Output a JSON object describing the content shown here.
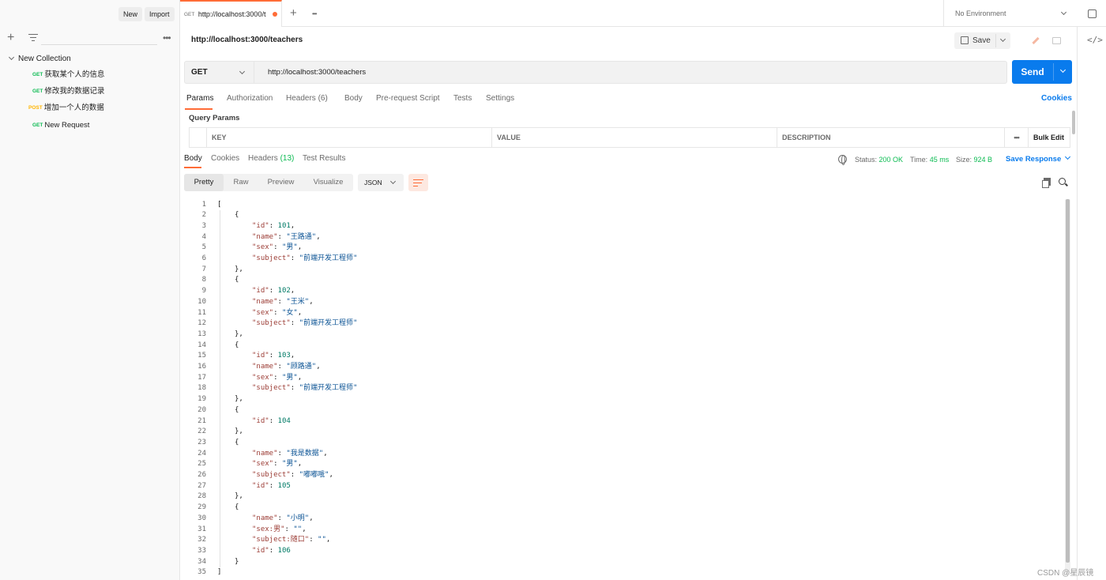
{
  "sidebar": {
    "new_label": "New",
    "import_label": "Import",
    "collection_name": "New Collection",
    "requests": [
      {
        "method": "GET",
        "name": "获取某个人的信息"
      },
      {
        "method": "GET",
        "name": "修改我的数据记录"
      },
      {
        "method": "POST",
        "name": "增加一个人的数据"
      },
      {
        "method": "GET",
        "name": "New Request"
      }
    ]
  },
  "tabs": {
    "active_tab": {
      "method": "GET",
      "title": "http://localhost:3000/t"
    },
    "environment": "No Environment"
  },
  "request": {
    "title": "http://localhost:3000/teachers",
    "save_label": "Save",
    "method": "GET",
    "url": "http://localhost:3000/teachers",
    "send_label": "Send",
    "tabs": [
      "Params",
      "Authorization",
      "Headers",
      "Body",
      "Pre-request Script",
      "Tests",
      "Settings"
    ],
    "headers_count": "(6)",
    "cookies_label": "Cookies",
    "query_params_title": "Query Params",
    "params_columns": [
      "KEY",
      "VALUE",
      "DESCRIPTION"
    ],
    "bulk_edit_label": "Bulk Edit"
  },
  "response": {
    "tabs": [
      "Body",
      "Cookies",
      "Headers",
      "Test Results"
    ],
    "headers_count": "(13)",
    "status_label": "Status:",
    "status_value": "200 OK",
    "time_label": "Time:",
    "time_value": "45 ms",
    "size_label": "Size:",
    "size_value": "924 B",
    "save_response_label": "Save Response",
    "view_modes": [
      "Pretty",
      "Raw",
      "Preview",
      "Visualize"
    ],
    "format": "JSON",
    "line_numbers": [
      "1",
      "2",
      "3",
      "4",
      "5",
      "6",
      "7",
      "8",
      "9",
      "10",
      "11",
      "12",
      "13",
      "14",
      "15",
      "16",
      "17",
      "18",
      "19",
      "20",
      "21",
      "22",
      "23",
      "24",
      "25",
      "26",
      "27",
      "28",
      "29",
      "30",
      "31",
      "32",
      "33",
      "34",
      "35"
    ],
    "lines": [
      {
        "indent": 0,
        "text": "["
      },
      {
        "indent": 1,
        "text": "{"
      },
      {
        "indent": 2,
        "key": "\"id\"",
        "num": "101",
        "tail": ","
      },
      {
        "indent": 2,
        "key": "\"name\"",
        "str": "\"王路通\"",
        "tail": ","
      },
      {
        "indent": 2,
        "key": "\"sex\"",
        "str": "\"男\"",
        "tail": ","
      },
      {
        "indent": 2,
        "key": "\"subject\"",
        "str": "\"前端开发工程师\"",
        "tail": ""
      },
      {
        "indent": 1,
        "text": "},"
      },
      {
        "indent": 1,
        "text": "{"
      },
      {
        "indent": 2,
        "key": "\"id\"",
        "num": "102",
        "tail": ","
      },
      {
        "indent": 2,
        "key": "\"name\"",
        "str": "\"王米\"",
        "tail": ","
      },
      {
        "indent": 2,
        "key": "\"sex\"",
        "str": "\"女\"",
        "tail": ","
      },
      {
        "indent": 2,
        "key": "\"subject\"",
        "str": "\"前端开发工程师\"",
        "tail": ""
      },
      {
        "indent": 1,
        "text": "},"
      },
      {
        "indent": 1,
        "text": "{"
      },
      {
        "indent": 2,
        "key": "\"id\"",
        "num": "103",
        "tail": ","
      },
      {
        "indent": 2,
        "key": "\"name\"",
        "str": "\"顾路通\"",
        "tail": ","
      },
      {
        "indent": 2,
        "key": "\"sex\"",
        "str": "\"男\"",
        "tail": ","
      },
      {
        "indent": 2,
        "key": "\"subject\"",
        "str": "\"前端开发工程师\"",
        "tail": ""
      },
      {
        "indent": 1,
        "text": "},"
      },
      {
        "indent": 1,
        "text": "{"
      },
      {
        "indent": 2,
        "key": "\"id\"",
        "num": "104",
        "tail": ""
      },
      {
        "indent": 1,
        "text": "},"
      },
      {
        "indent": 1,
        "text": "{"
      },
      {
        "indent": 2,
        "key": "\"name\"",
        "str": "\"我是数据\"",
        "tail": ","
      },
      {
        "indent": 2,
        "key": "\"sex\"",
        "str": "\"男\"",
        "tail": ","
      },
      {
        "indent": 2,
        "key": "\"subject\"",
        "str": "\"嘟嘟哦\"",
        "tail": ","
      },
      {
        "indent": 2,
        "key": "\"id\"",
        "num": "105",
        "tail": ""
      },
      {
        "indent": 1,
        "text": "},"
      },
      {
        "indent": 1,
        "text": "{"
      },
      {
        "indent": 2,
        "key": "\"name\"",
        "str": "\"小明\"",
        "tail": ","
      },
      {
        "indent": 2,
        "key": "\"sex:男\"",
        "str": "\"\"",
        "tail": ","
      },
      {
        "indent": 2,
        "key": "\"subject:随口\"",
        "str": "\"\"",
        "tail": ","
      },
      {
        "indent": 2,
        "key": "\"id\"",
        "num": "106",
        "tail": ""
      },
      {
        "indent": 1,
        "text": "}"
      },
      {
        "indent": 0,
        "text": "]"
      }
    ]
  },
  "watermark": "CSDN @星辰镜",
  "colors": {
    "accent": "#ff6c37",
    "primary": "#097bed",
    "get": "#0cbb52",
    "post": "#ffb400"
  }
}
